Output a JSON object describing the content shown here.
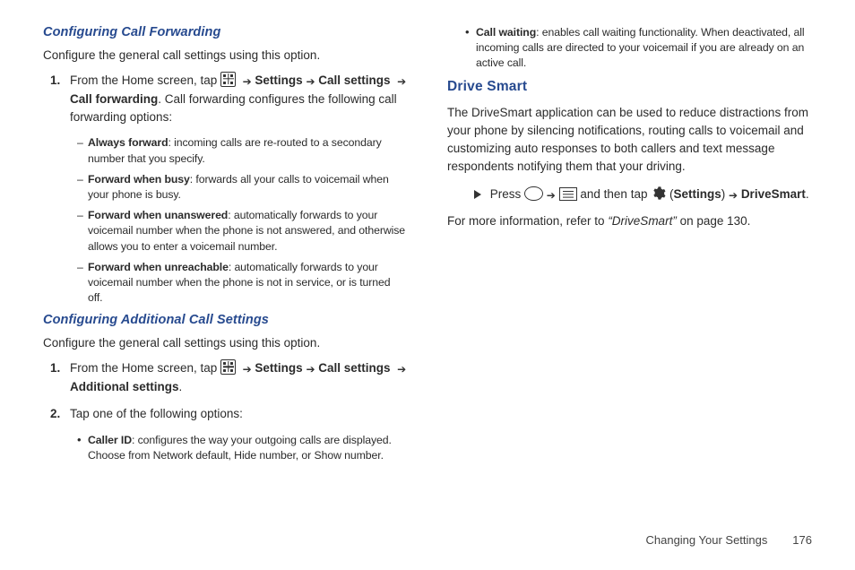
{
  "left": {
    "h1": "Configuring Call Forwarding",
    "intro1": "Configure the general call settings using this option.",
    "step1_lead": "From the Home screen, tap ",
    "step1_seq_a": "Settings",
    "step1_seq_b": "Call settings",
    "step1_seq_c": "Call forwarding",
    "step1_tail": ". Call forwarding configures the following call forwarding options:",
    "opts": [
      {
        "title": "Always forward",
        "body": ": incoming calls are re-routed to a secondary number that you specify."
      },
      {
        "title": "Forward when busy",
        "body": ": forwards all your calls to voicemail when your phone is busy."
      },
      {
        "title": "Forward when unanswered",
        "body": ": automatically forwards to your voicemail number when the phone is not answered, and otherwise allows you to enter a voicemail number."
      },
      {
        "title": "Forward when unreachable",
        "body": ": automatically forwards to your voicemail number when the phone is not in service, or is turned off."
      }
    ],
    "h2": "Configuring Additional Call Settings",
    "intro2": "Configure the general call settings using this option.",
    "step2_lead": "From the Home screen, tap ",
    "step2_seq_a": "Settings",
    "step2_seq_b": "Call settings",
    "step2_seq_c": "Additional settings",
    "step2_intro": "Tap one of the following options:",
    "bullet1_title": "Caller ID",
    "bullet1_body": ": configures the way your outgoing calls are displayed. Choose from Network default, Hide number, or Show number."
  },
  "right": {
    "bullet_cw_title": "Call waiting",
    "bullet_cw_body": ": enables call waiting functionality. When deactivated, all incoming calls are directed to your voicemail if you are already on an active call.",
    "h": "Drive Smart",
    "para": "The DriveSmart application can be used to reduce distractions from your phone by silencing notifications, routing calls to voicemail and customizing auto responses to both callers and text message respondents notifying them that your driving.",
    "step_press": "Press ",
    "step_andthen": " and then tap ",
    "step_settings": "Settings",
    "step_ds": "DriveSmart",
    "more_a": "For more information, refer to ",
    "more_quote": "“DriveSmart”",
    "more_b": "  on page 130."
  },
  "footer": {
    "chapter": "Changing Your Settings",
    "page": "176"
  }
}
